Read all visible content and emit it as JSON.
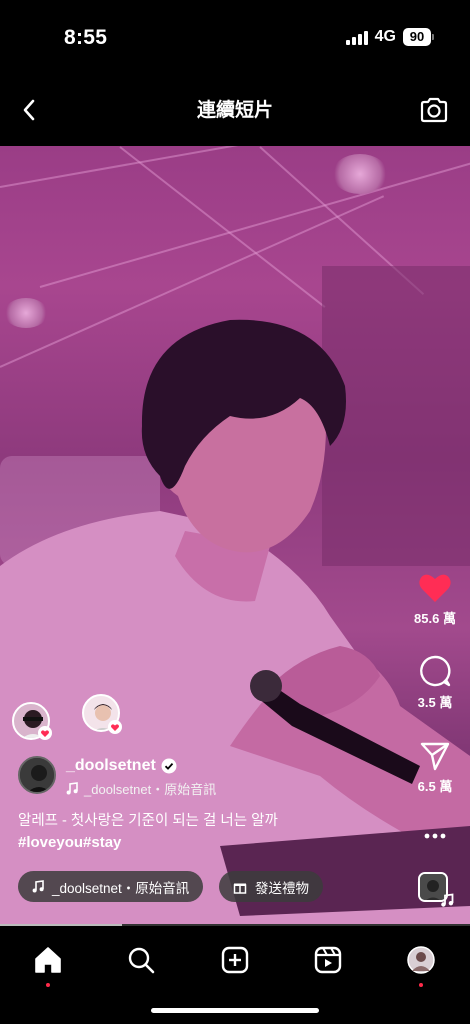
{
  "status_bar": {
    "time": "8:55",
    "network": "4G",
    "battery": "90"
  },
  "header": {
    "title": "連續短片"
  },
  "actions": {
    "likes": "85.6 萬",
    "comments": "3.5 萬",
    "shares": "6.5 萬"
  },
  "post": {
    "username": "_doolsetnet",
    "audio_label": "_doolsetnet・原始音訊",
    "caption_line1": "알레프 - 첫사랑은 기준이 되는 걸 너는 알까",
    "caption_tags": "#loveyou#stay"
  },
  "chips": {
    "audio": "_doolsetnet・原始音訊",
    "gift": "發送禮物"
  },
  "progress": {
    "fraction": 0.26
  },
  "colors": {
    "accent_red": "#ff2a4a",
    "like_red": "#ff2d55",
    "background": "#000000",
    "tint": "#a8468f"
  },
  "icons": {
    "back": "chevron-left-icon",
    "camera": "camera-icon",
    "like": "heart-icon",
    "comment": "comment-icon",
    "share": "paper-plane-icon",
    "more": "more-dots-icon",
    "home": "home-icon",
    "search": "search-icon",
    "create": "plus-square-icon",
    "reels": "reels-icon",
    "profile": "profile-avatar-icon"
  }
}
